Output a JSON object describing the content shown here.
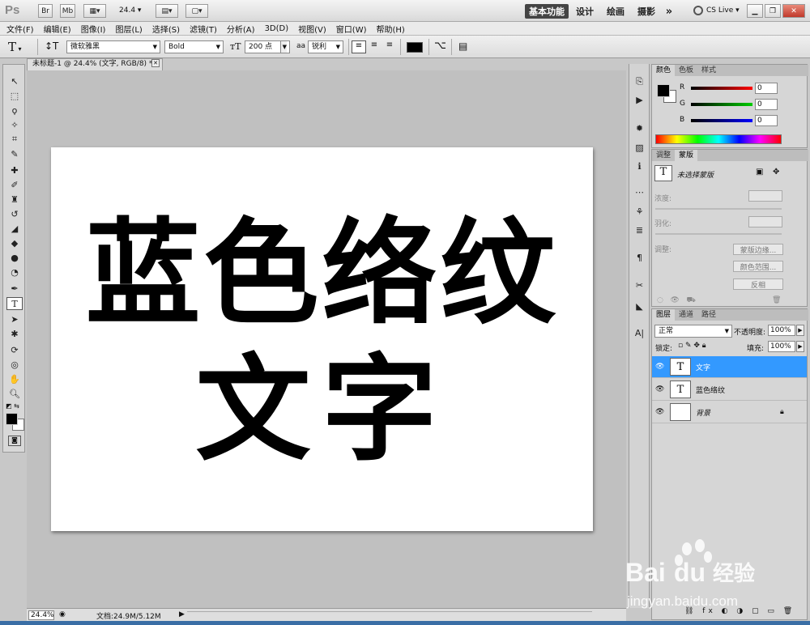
{
  "appbar": {
    "logo": "Ps",
    "br": "Br",
    "mb": "Mb",
    "zoom": "24.4",
    "workspaces": [
      "基本功能",
      "设计",
      "绘画",
      "摄影"
    ],
    "more": "»",
    "cslive": "CS Live"
  },
  "menu": [
    "文件(F)",
    "编辑(E)",
    "图像(I)",
    "图层(L)",
    "选择(S)",
    "滤镜(T)",
    "分析(A)",
    "3D(D)",
    "视图(V)",
    "窗口(W)",
    "帮助(H)"
  ],
  "options": {
    "font_family": "微软雅黑",
    "font_style": "Bold",
    "font_size": "200 点",
    "aa_label": "aa",
    "aa_mode": "锐利",
    "text_color": "#000000"
  },
  "document": {
    "tab_title": "未标题-1 @ 24.4% (文字, RGB/8) *",
    "line1": "蓝色络纹",
    "line2": "文字"
  },
  "status": {
    "zoom": "24.4%",
    "doc_info": "文档:24.9M/5.12M"
  },
  "color_panel": {
    "tabs": [
      "颜色",
      "色板",
      "样式"
    ],
    "r_label": "R",
    "r_value": "0",
    "g_label": "G",
    "g_value": "0",
    "b_label": "B",
    "b_value": "0",
    "fg_color": "#000000",
    "bg_color": "#ffffff"
  },
  "masks_panel": {
    "tabs": [
      "调整",
      "蒙版"
    ],
    "no_mask": "未选择蒙版",
    "density": "浓度:",
    "feather": "羽化:",
    "refine": "调整:",
    "btn_mask_edge": "蒙版边缘...",
    "btn_color_range": "颜色范围...",
    "btn_invert": "反相"
  },
  "layers_panel": {
    "tabs": [
      "图层",
      "通道",
      "路径"
    ],
    "blend_mode": "正常",
    "opacity_label": "不透明度:",
    "opacity_value": "100%",
    "lock_label": "锁定:",
    "fill_label": "填充:",
    "fill_value": "100%",
    "layers": [
      {
        "name": "文字",
        "thumb": "T",
        "active": true
      },
      {
        "name": "蓝色络纹",
        "thumb": "T",
        "active": false
      },
      {
        "name": "背景",
        "thumb": "",
        "active": false
      }
    ]
  },
  "watermark": {
    "brand": "Bai",
    "brand2": "du",
    "cn": "经验",
    "url": "jingyan.baidu.com"
  },
  "colors": {
    "accent": "#3399ff",
    "taskbar": "#3a6ea5"
  }
}
